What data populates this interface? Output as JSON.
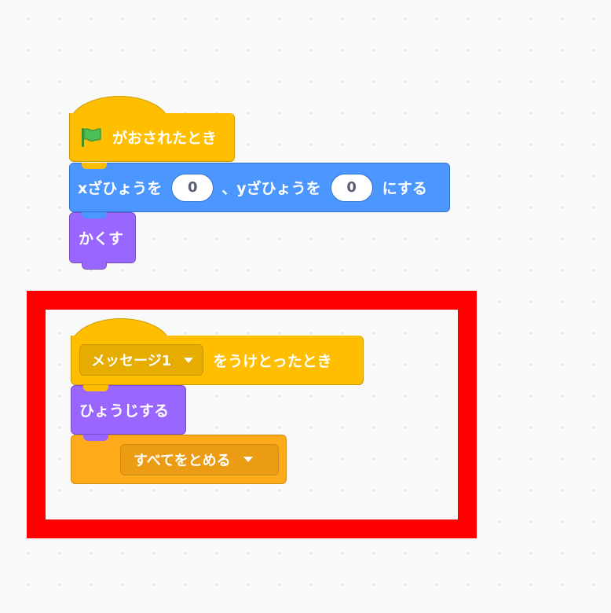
{
  "workspace": {
    "script1": {
      "hat": {
        "flag_icon": "green-flag-icon",
        "label": "がおされたとき"
      },
      "goto": {
        "label_x": "xざひょうを",
        "x_value": "0",
        "label_y": "、yざひょうを",
        "y_value": "0",
        "label_end": "にする"
      },
      "hide": {
        "label": "かくす"
      }
    },
    "script2": {
      "hat": {
        "message_value": "メッセージ1",
        "label": "をうけとったとき"
      },
      "show": {
        "label": "ひょうじする"
      },
      "stop": {
        "option_value": "すべてをとめる"
      }
    }
  },
  "highlight": {
    "color": "#ff0000"
  },
  "colors": {
    "events": "#ffbf00",
    "events_border": "#cc9900",
    "events_dropdown": "#e6ac00",
    "motion": "#4c97ff",
    "motion_border": "#3373cc",
    "looks": "#9966ff",
    "looks_border": "#774dcb",
    "control": "#ffab19",
    "control_border": "#cf8b17",
    "control_dropdown": "#ec9c13"
  }
}
